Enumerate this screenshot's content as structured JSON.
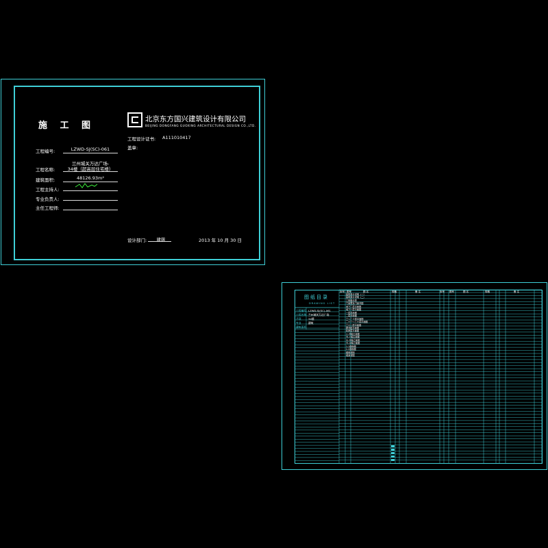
{
  "cover": {
    "title": "施 工 图",
    "company_cn": "北京东方国兴建筑设计有限公司",
    "company_en": "BEIJING DONGFANG GUOXING ARCHITECTURAL DESIGN CO.,LTD.",
    "license_label": "工程设计证书:",
    "license_no": "A111010417",
    "seal_label": "盖章:",
    "fields": [
      {
        "label": "工程编号:",
        "value": "LZWD-SJ(SC)-061"
      },
      {
        "label": "工程名称:",
        "value": "兰州城关万达广场-",
        "value2": "34楼（超高层住宅楼）"
      },
      {
        "label": "建筑面积:",
        "value": "48126.93m²"
      },
      {
        "label": "工程主持人:",
        "value": ""
      },
      {
        "label": "专业负责人:",
        "value": ""
      },
      {
        "label": "主任工程师:",
        "value": ""
      }
    ],
    "dept_label": "设计部门:",
    "dept_value": "建筑",
    "date": "2013 年 10 月 30 日"
  },
  "drawing_list": {
    "title": "图纸目录",
    "subtitle": "DRAWING LIST",
    "info_labels": [
      "工程编号",
      "工程名称",
      "子项",
      "专业",
      "建筑面积"
    ],
    "info_values": [
      "LZWD-SJ(SC)-061",
      "兰州城关万达广场",
      "34楼",
      "建筑",
      ""
    ],
    "col_headers": [
      "序号",
      "图号",
      "图 名",
      "规格",
      "备 注",
      "序号",
      "图号",
      "图 名",
      "规格",
      "备 注"
    ],
    "entries": [
      "建筑设计说明（一）",
      "建筑设计说明（二）",
      "工程做法表",
      "门窗表及门窗详图",
      "地下二层平面图",
      "地下一层平面图",
      "一层平面图",
      "二层平面图",
      "三～二十层平面图",
      "二十一～三十层平面图",
      "三十一层平面图",
      "屋顶层平面图",
      "机房层平面图",
      "①-⑲轴立面图",
      "⑲-①轴立面图",
      "Ⓐ-Ⓗ轴立面图",
      "Ⓗ-Ⓐ轴立面图",
      "1-1剖面图",
      "2-2剖面图",
      "楼梯详图",
      "墙身详图"
    ]
  }
}
